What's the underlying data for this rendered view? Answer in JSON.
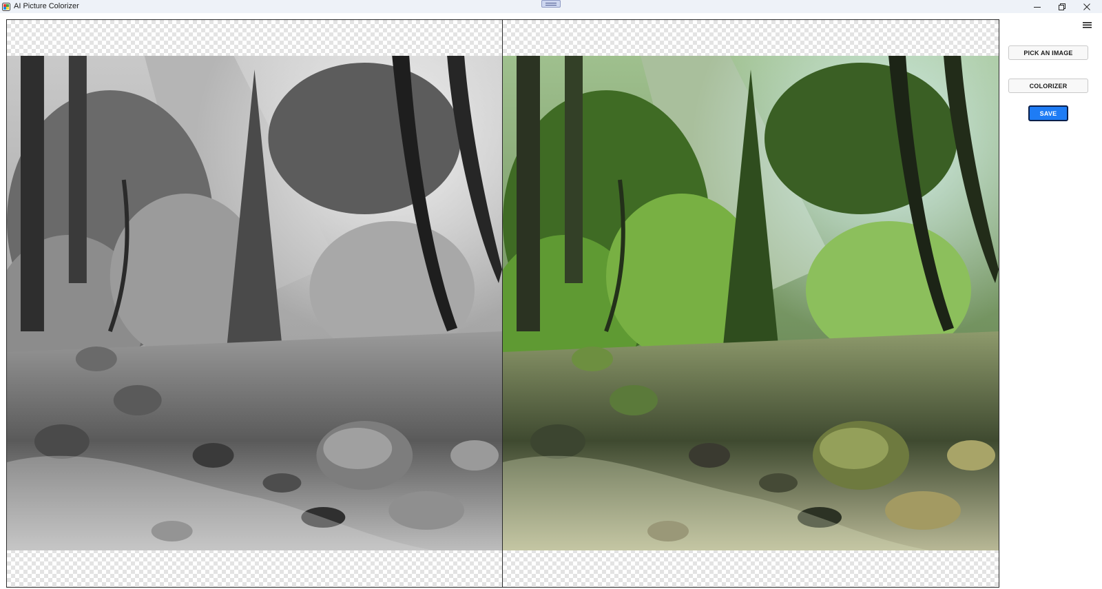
{
  "window": {
    "title": "AI Picture Colorizer",
    "controls": [
      "minimize-icon",
      "restore-icon",
      "close-icon"
    ]
  },
  "panels": {
    "original": {
      "description_icon": "grayscale-forest-river-photo"
    },
    "colorized": {
      "description_icon": "colorized-forest-river-photo"
    }
  },
  "sidebar": {
    "menu_icon": "hamburger-menu-icon",
    "pick_label": "PICK AN IMAGE",
    "colorize_label": "COLORIZER",
    "save_label": "SAVE"
  },
  "colors": {
    "accent": "#1e7cf5",
    "titlebar": "#eef2f8",
    "checker": "#e3e3e3"
  }
}
